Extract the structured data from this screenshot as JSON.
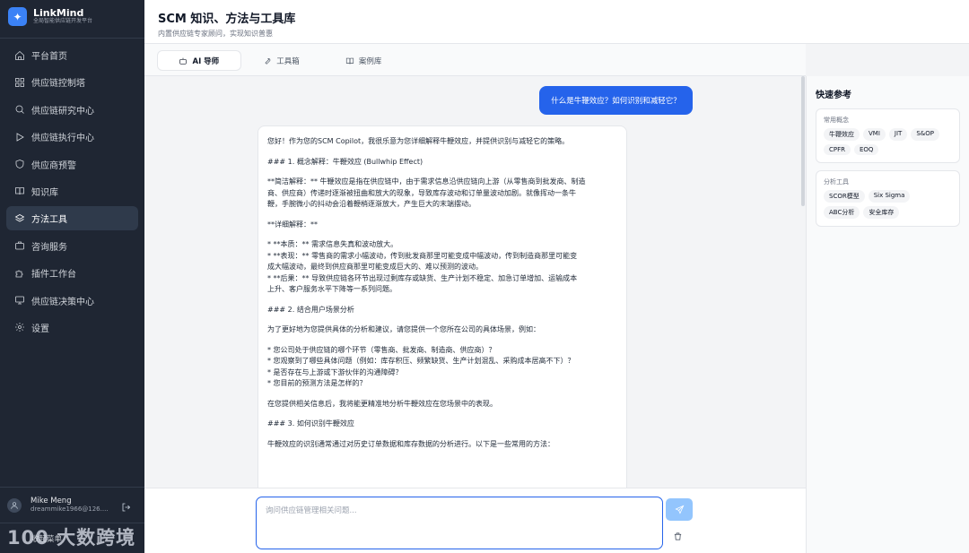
{
  "brand": {
    "name": "LinkMind",
    "tagline": "全局智能供应链开发平台"
  },
  "sidebar": {
    "items": [
      {
        "label": "平台首页",
        "icon": "home-icon"
      },
      {
        "label": "供应链控制塔",
        "icon": "grid-icon"
      },
      {
        "label": "供应链研究中心",
        "icon": "search-icon"
      },
      {
        "label": "供应链执行中心",
        "icon": "play-icon"
      },
      {
        "label": "供应商预警",
        "icon": "shield-icon"
      },
      {
        "label": "知识库",
        "icon": "book-icon"
      },
      {
        "label": "方法工具",
        "icon": "layers-icon",
        "active": true
      },
      {
        "label": "咨询服务",
        "icon": "briefcase-icon"
      },
      {
        "label": "插件工作台",
        "icon": "puzzle-icon"
      },
      {
        "label": "供应链决策中心",
        "icon": "monitor-icon"
      },
      {
        "label": "设置",
        "icon": "gear-icon"
      }
    ]
  },
  "user": {
    "name": "Mike Meng",
    "email": "dreammike1966@126...."
  },
  "collapse_label": "收起菜单",
  "watermark": "100 大数跨境",
  "header": {
    "title": "SCM 知识、方法与工具库",
    "subtitle": "内置供应链专家顾问，实现知识普惠"
  },
  "tabs": [
    {
      "label": "AI 导师",
      "icon": "bot-icon",
      "active": true
    },
    {
      "label": "工具箱",
      "icon": "wrench-icon"
    },
    {
      "label": "案例库",
      "icon": "open-book-icon"
    }
  ],
  "chat": {
    "user_message": "什么是牛鞭效应？如何识别和减轻它？",
    "bot_lines": [
      "您好！作为您的SCM Copilot，我很乐意为您详细解释牛鞭效应，并提供识别与减轻它的策略。",
      "",
      "### 1. 概念解释：牛鞭效应 (Bullwhip Effect)",
      "",
      "**简洁解释：** 牛鞭效应是指在供应链中，由于需求信息沿供应链向上游（从零售商到批发商、制造",
      "商、供应商）传递时逐渐被扭曲和放大的现象，导致库存波动和订单量波动加剧。就像挥动一条牛",
      "鞭，手腕微小的抖动会沿着鞭梢逐渐放大，产生巨大的末端摆动。",
      "",
      "**详细解释：**",
      "",
      "*   **本质：** 需求信息失真和波动放大。",
      "*   **表现：** 零售商的需求小幅波动，传到批发商那里可能变成中幅波动，传到制造商那里可能变",
      "成大幅波动，最终到供应商那里可能变成巨大的、难以预测的波动。",
      "*   **后果：** 导致供应链各环节出现过剩库存或缺货、生产计划不稳定、加急订单增加、运输成本",
      "上升、客户服务水平下降等一系列问题。",
      "",
      "### 2. 结合用户场景分析",
      "",
      "为了更好地为您提供具体的分析和建议，请您提供一个您所在公司的具体场景，例如：",
      "",
      "*   您公司处于供应链的哪个环节（零售商、批发商、制造商、供应商）？",
      "*   您观察到了哪些具体问题（例如：库存积压、频繁缺货、生产计划混乱、采购成本居高不下）？",
      "*   是否存在与上游或下游伙伴的沟通障碍？",
      "*   您目前的预测方法是怎样的？",
      "",
      "在您提供相关信息后，我将能更精准地分析牛鞭效应在您场景中的表现。",
      "",
      "### 3. 如何识别牛鞭效应",
      "",
      "牛鞭效应的识别通常通过对历史订单数据和库存数据的分析进行。以下是一些常用的方法："
    ]
  },
  "input": {
    "placeholder": "询问供应链管理相关问题..."
  },
  "right_panel": {
    "title": "快速参考",
    "cards": [
      {
        "title": "常用概念",
        "chips": [
          "牛鞭效应",
          "VMI",
          "JIT",
          "S&OP",
          "CPFR",
          "EOQ"
        ]
      },
      {
        "title": "分析工具",
        "chips": [
          "SCOR模型",
          "Six Sigma",
          "ABC分析",
          "安全库存"
        ]
      }
    ]
  },
  "colors": {
    "sidebar_bg": "#1f2633",
    "accent": "#2563eb",
    "send_disabled": "#93c5fd"
  }
}
